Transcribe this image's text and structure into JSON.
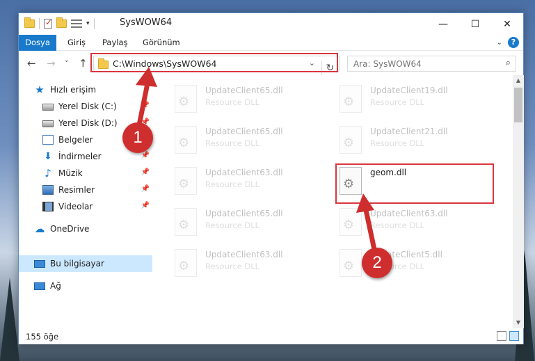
{
  "window": {
    "title": "SysWOW64",
    "controls": {
      "minimize": "—",
      "maximize": "☐",
      "close": "✕"
    }
  },
  "ribbon": {
    "tabs": [
      "Dosya",
      "Giriş",
      "Paylaş",
      "Görünüm"
    ]
  },
  "navigation": {
    "back": "←",
    "forward": "→",
    "recent": "˅",
    "up": "↑",
    "address": "C:\\Windows\\SysWOW64",
    "refresh": "↻",
    "search_placeholder": "Ara: SysWOW64"
  },
  "sidebar": {
    "items": [
      {
        "label": "Hızlı erişim",
        "icon": "star-icon"
      },
      {
        "label": "Yerel Disk (C:)",
        "icon": "drive-icon"
      },
      {
        "label": "Yerel Disk (D:)",
        "icon": "drive-icon"
      },
      {
        "label": "Belgeler",
        "icon": "documents-icon"
      },
      {
        "label": "İndirmeler",
        "icon": "download-icon"
      },
      {
        "label": "Müzik",
        "icon": "music-icon"
      },
      {
        "label": "Resimler",
        "icon": "pictures-icon"
      },
      {
        "label": "Videolar",
        "icon": "video-icon"
      },
      {
        "label": "OneDrive",
        "icon": "cloud-icon"
      },
      {
        "label": "Bu bilgisayar",
        "icon": "computer-icon"
      },
      {
        "label": "Ağ",
        "icon": "network-icon"
      }
    ]
  },
  "files": [
    {
      "name": "UpdateClient65.dll",
      "desc": "Resource DLL"
    },
    {
      "name": "UpdateClient19.dll",
      "desc": "Resource DLL"
    },
    {
      "name": "UpdateClient65.dll",
      "desc": "Resource DLL"
    },
    {
      "name": "UpdateClient21.dll",
      "desc": "Resource DLL"
    },
    {
      "name": "UpdateClient63.dll",
      "desc": "Resource DLL"
    },
    {
      "name": "geom.dll",
      "desc": ""
    },
    {
      "name": "UpdateClient65.dll",
      "desc": "Resource DLL"
    },
    {
      "name": "UpdateClient63.dll",
      "desc": "Resource DLL"
    },
    {
      "name": "UpdateClient63.dll",
      "desc": "Resource DLL"
    },
    {
      "name": "UpdateClient5.dll",
      "desc": "Resource DLL"
    }
  ],
  "status": {
    "item_count": "155 öğe"
  },
  "annotations": {
    "step1": "1",
    "step2": "2",
    "color": "#d9363e"
  }
}
